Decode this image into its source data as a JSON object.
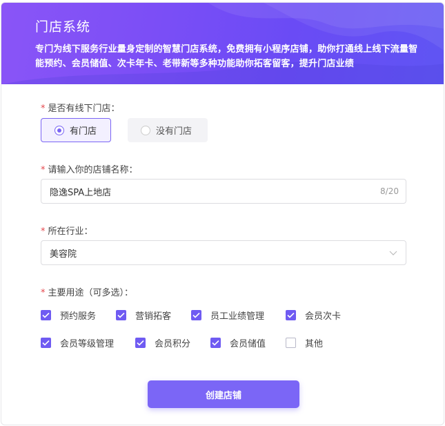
{
  "banner": {
    "title": "门店系统",
    "description": "专门为线下服务行业量身定制的智慧门店系统，免费拥有小程序店铺，助你打通线上线下流量智能预约、会员储值、次卡年卡、老带新等多种功能助你拓客留客，提升门店业绩"
  },
  "store_question": {
    "required_mark": "*",
    "label": "是否有线下门店：",
    "options": [
      {
        "label": "有门店",
        "selected": true
      },
      {
        "label": "没有门店",
        "selected": false
      }
    ]
  },
  "store_name": {
    "required_mark": "*",
    "label": "请输入你的店铺名称：",
    "value": "隐逸SPA上地店",
    "counter": "8/20"
  },
  "industry": {
    "required_mark": "*",
    "label": "所在行业：",
    "value": "美容院"
  },
  "usage": {
    "required_mark": "*",
    "label": "主要用途（可多选）：",
    "options": [
      {
        "label": "预约服务",
        "checked": true
      },
      {
        "label": "营销拓客",
        "checked": true
      },
      {
        "label": "员工业绩管理",
        "checked": true
      },
      {
        "label": "会员次卡",
        "checked": true
      },
      {
        "label": "会员等级管理",
        "checked": true
      },
      {
        "label": "会员积分",
        "checked": true
      },
      {
        "label": "会员储值",
        "checked": true
      },
      {
        "label": "其他",
        "checked": false
      }
    ]
  },
  "submit_label": "创建店铺",
  "colors": {
    "accent": "#6f5bf2",
    "required": "#e5484d",
    "banner_start": "#8a55f7",
    "banner_end": "#5f55f3"
  }
}
